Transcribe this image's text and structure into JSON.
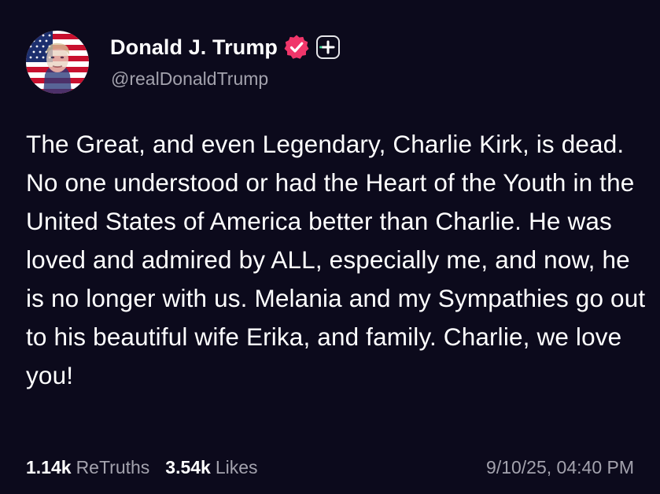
{
  "author": {
    "display_name": "Donald J. Trump",
    "handle": "@realDonaldTrump",
    "avatar_icon": "flag-portrait-avatar",
    "verified_icon": "verified-badge-icon",
    "verified_color": "#f0366a",
    "follow_icon": "plus-icon"
  },
  "post": {
    "text": "The Great, and even Legendary, Charlie Kirk, is dead. No one understood or had the Heart of the Youth in the United States of America better than Charlie. He was loved and admired by ALL, especially me, and now, he is no longer with us. Melania and my Sympathies go out to his beautiful wife Erika, and family. Charlie, we love you!"
  },
  "stats": {
    "retruths_count": "1.14k",
    "retruths_label": "ReTruths",
    "likes_count": "3.54k",
    "likes_label": "Likes",
    "timestamp": "9/10/25, 04:40 PM"
  },
  "colors": {
    "background": "#0c0a1c",
    "text_primary": "#ffffff",
    "text_secondary": "#a3a2ad",
    "accent_green": "#3ddc97"
  }
}
